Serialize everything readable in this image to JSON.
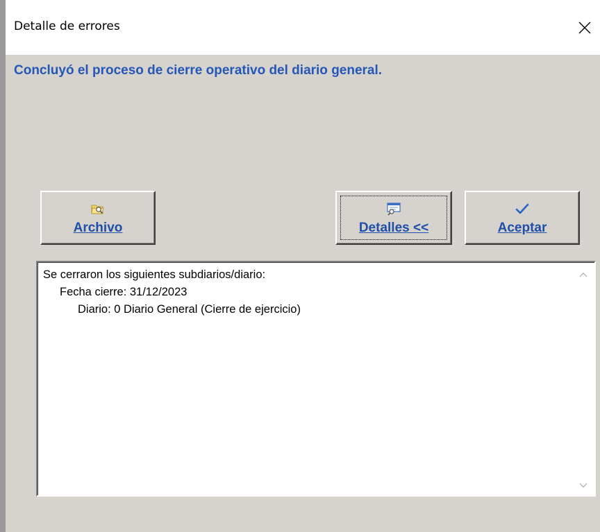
{
  "window": {
    "title": "Detalle de errores"
  },
  "message": "Concluyó el proceso de cierre operativo del diario general.",
  "buttons": {
    "archivo": "Archivo",
    "detalles": "Detalles <<",
    "aceptar": "Aceptar"
  },
  "details": {
    "line1": "Se cerraron los siguientes subdiarios/diario:",
    "line2": "Fecha cierre: 31/12/2023",
    "line3": "Diario: 0 Diario General (Cierre de ejercicio)"
  },
  "icons": {
    "close": "close-icon",
    "archivo": "folder-search-icon",
    "detalles": "details-icon",
    "aceptar": "checkmark-icon",
    "scroll_up": "chevron-up-icon",
    "scroll_down": "chevron-down-icon"
  },
  "colors": {
    "message_text": "#2457b8",
    "button_text": "#1f4fa8",
    "dialog_background": "#d6d3ce"
  }
}
